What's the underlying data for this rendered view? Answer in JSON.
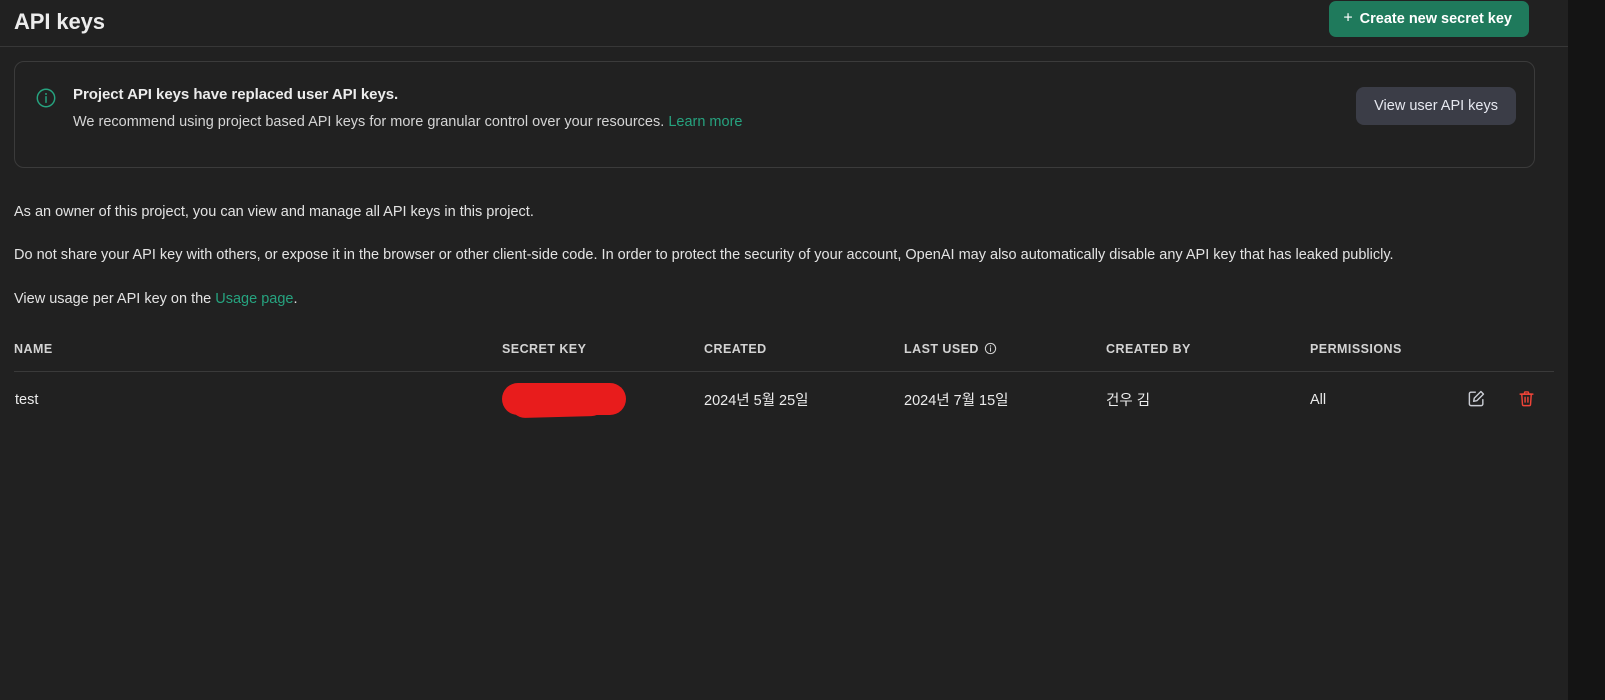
{
  "header": {
    "title": "API keys",
    "create_button": {
      "label": "Create new secret key",
      "icon": "plus-icon",
      "color": "#1f7a5c"
    }
  },
  "banner": {
    "icon": "info-circle-icon",
    "icon_color": "#26a37f",
    "title": "Project API keys have replaced user API keys.",
    "description": "We recommend using project based API keys for more granular control over your resources.",
    "learn_more_label": "Learn more",
    "view_user_keys_label": "View user API keys"
  },
  "prose": {
    "paragraph_1": "As an owner of this project, you can view and manage all API keys in this project.",
    "paragraph_2": "Do not share your API key with others, or expose it in the browser or other client-side code. In order to protect the security of your account, OpenAI may also automatically disable any API key that has leaked publicly.",
    "paragraph_3_prefix": "View usage per API key on the ",
    "paragraph_3_link": "Usage page",
    "paragraph_3_suffix": ".",
    "link_color": "#26a37f"
  },
  "table": {
    "columns": [
      {
        "key": "name",
        "label": "NAME"
      },
      {
        "key": "secret_key",
        "label": "SECRET KEY"
      },
      {
        "key": "created",
        "label": "CREATED"
      },
      {
        "key": "last_used",
        "label": "LAST USED",
        "icon": "info-circle-icon"
      },
      {
        "key": "created_by",
        "label": "CREATED BY"
      },
      {
        "key": "permissions",
        "label": "PERMISSIONS"
      },
      {
        "key": "actions",
        "label": ""
      }
    ],
    "rows": [
      {
        "name": "test",
        "secret_key": "",
        "secret_key_redacted": true,
        "redaction_color": "#e81c1c",
        "created": "2024년 5월 25일",
        "last_used": "2024년 7월 15일",
        "created_by": "건우 김",
        "permissions": "All",
        "actions": [
          {
            "name": "edit-key-button",
            "icon": "edit-pencil-square-icon",
            "color": "#c9ccd3"
          },
          {
            "name": "delete-key-button",
            "icon": "trash-icon",
            "color": "#f04438"
          }
        ]
      }
    ]
  }
}
